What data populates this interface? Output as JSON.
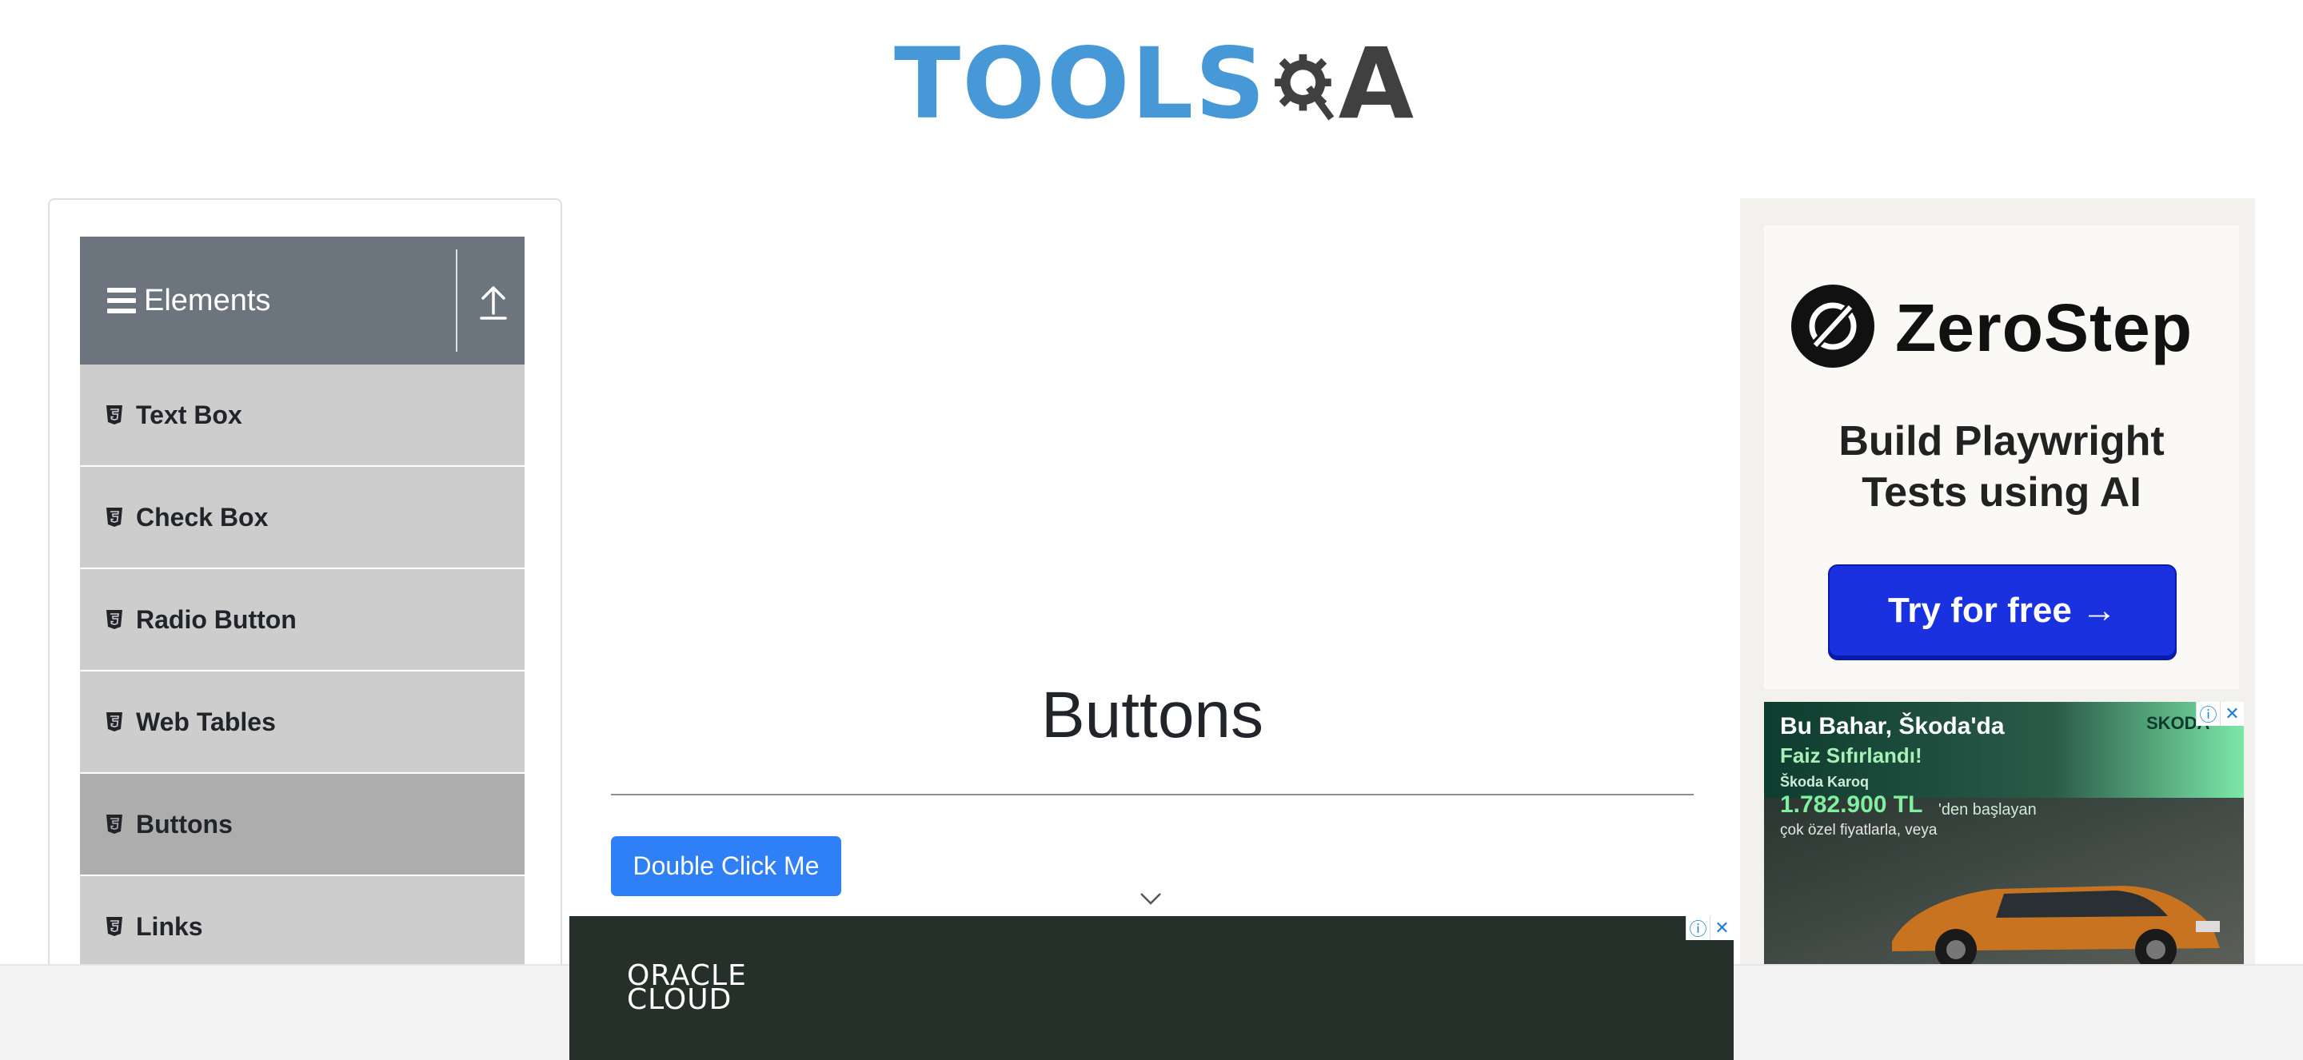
{
  "header": {
    "logo_text": "TOOLS",
    "logo_suffix": "A"
  },
  "sidebar": {
    "group_title": "Elements",
    "items": [
      {
        "label": "Text Box",
        "active": false
      },
      {
        "label": "Check Box",
        "active": false
      },
      {
        "label": "Radio Button",
        "active": false
      },
      {
        "label": "Web Tables",
        "active": false
      },
      {
        "label": "Buttons",
        "active": true
      },
      {
        "label": "Links",
        "active": false
      }
    ]
  },
  "main": {
    "title": "Buttons",
    "double_click_label": "Double Click Me"
  },
  "ads": {
    "zerostep": {
      "name": "ZeroStep",
      "tagline_1": "Build Playwright",
      "tagline_2": "Tests using AI",
      "cta": "Try for free →"
    },
    "skoda": {
      "headline": "Bu Bahar, Škoda'da",
      "subhead": "Faiz Sıfırlandı!",
      "brand": "SKODA",
      "model": "Škoda Karoq",
      "price": "1.782.900 TL",
      "price_suffix": "'den başlayan",
      "note": "çok özel fiyatlarla, veya"
    },
    "oracle": {
      "line1": "ORACLE",
      "line2": "CLOUD"
    },
    "ad_info_icon": "ⓘ",
    "ad_close_icon": "✕"
  },
  "colors": {
    "primary_button": "#2f7ff6",
    "sidebar_header": "#6c757d",
    "menu_item": "#cdcdcd",
    "menu_item_active": "#adadad",
    "logo_blue": "#4798d6"
  }
}
